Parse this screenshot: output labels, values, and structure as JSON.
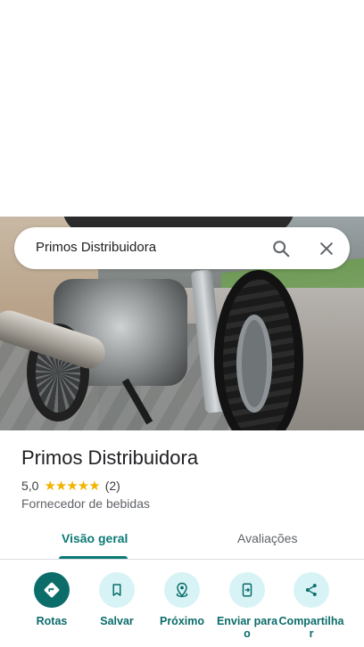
{
  "search": {
    "query": "Primos Distribuidora"
  },
  "place": {
    "name": "Primos Distribuidora",
    "rating": "5,0",
    "stars": "★★★★★",
    "review_count": "(2)",
    "category": "Fornecedor de bebidas"
  },
  "tabs": [
    {
      "label": "Visão geral",
      "active": true
    },
    {
      "label": "Avaliações",
      "active": false
    }
  ],
  "actions": [
    {
      "label": "Rotas",
      "icon": "directions-icon"
    },
    {
      "label": "Salvar",
      "icon": "bookmark-icon"
    },
    {
      "label": "Próximo",
      "icon": "nearby-icon"
    },
    {
      "label": "Enviar para\no",
      "icon": "send-to-phone-icon"
    },
    {
      "label": "Compartilha\nr",
      "icon": "share-icon"
    }
  ],
  "colors": {
    "accent": "#0b6c6a",
    "action_bg": "#d8f3f6",
    "star": "#f2b400"
  }
}
